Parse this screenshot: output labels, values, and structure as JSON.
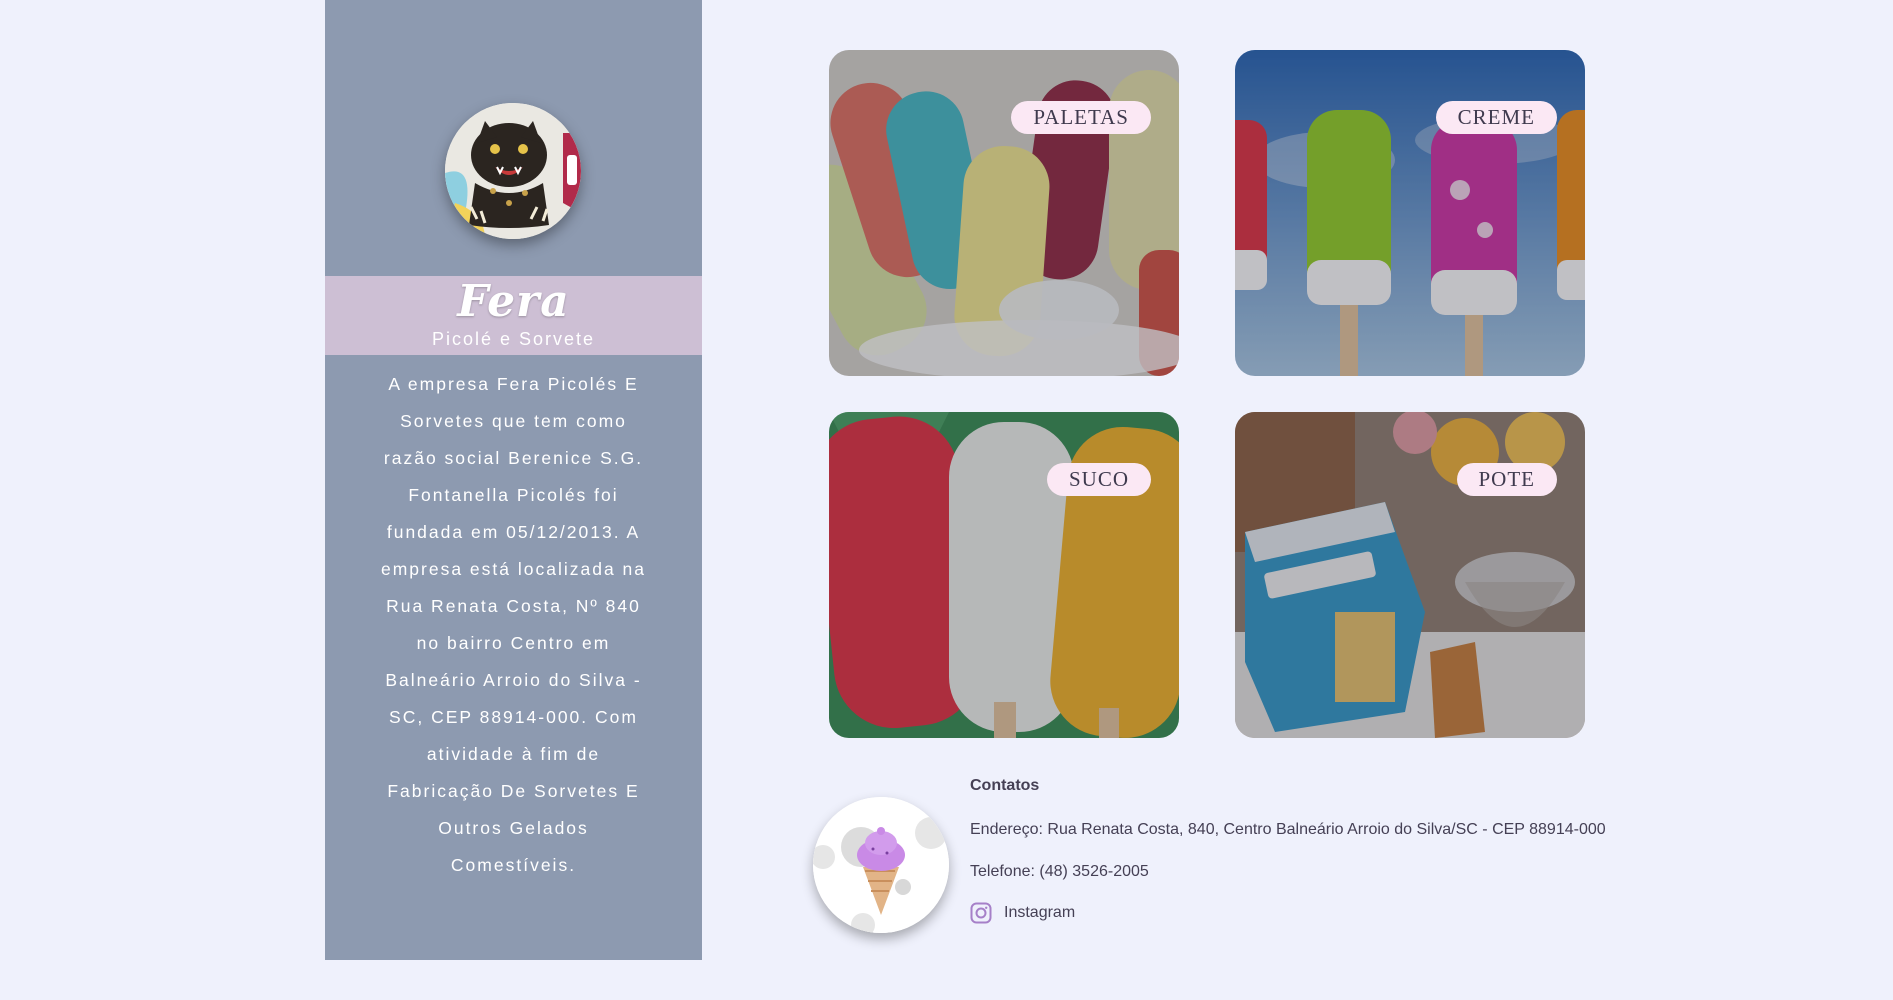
{
  "brand": {
    "name": "Fera",
    "subtitle": "Picolé e Sorvete",
    "about": "A empresa Fera Picolés E Sorvetes que tem como razão social Berenice S.G. Fontanella Picolés foi fundada em 05/12/2013. A empresa está localizada na Rua Renata Costa, Nº 840 no bairro Centro em Balneário Arroio do Silva - SC, CEP 88914-000. Com atividade à fim de Fabricação De Sorvetes E Outros Gelados Comestíveis."
  },
  "products": [
    {
      "label": "PALETAS"
    },
    {
      "label": "CREME"
    },
    {
      "label": "SUCO"
    },
    {
      "label": "POTE"
    }
  ],
  "contact": {
    "title": "Contatos",
    "address": "Endereço: Rua Renata Costa, 840, Centro Balneário Arroio do Silva/SC - CEP 88914-000",
    "phone": "Telefone: (48) 3526-2005",
    "instagram_label": "Instagram"
  },
  "icons": {
    "logo": "panther-logo",
    "contact": "ice-cream-icon",
    "social": "instagram-icon"
  },
  "colors": {
    "background": "#eff1fc",
    "sidebar": "#8d9ab0",
    "brand_band": "#cdbfd4",
    "pill": "#fbe8f4",
    "text_dark": "#454055",
    "instagram": "#a680c8"
  }
}
